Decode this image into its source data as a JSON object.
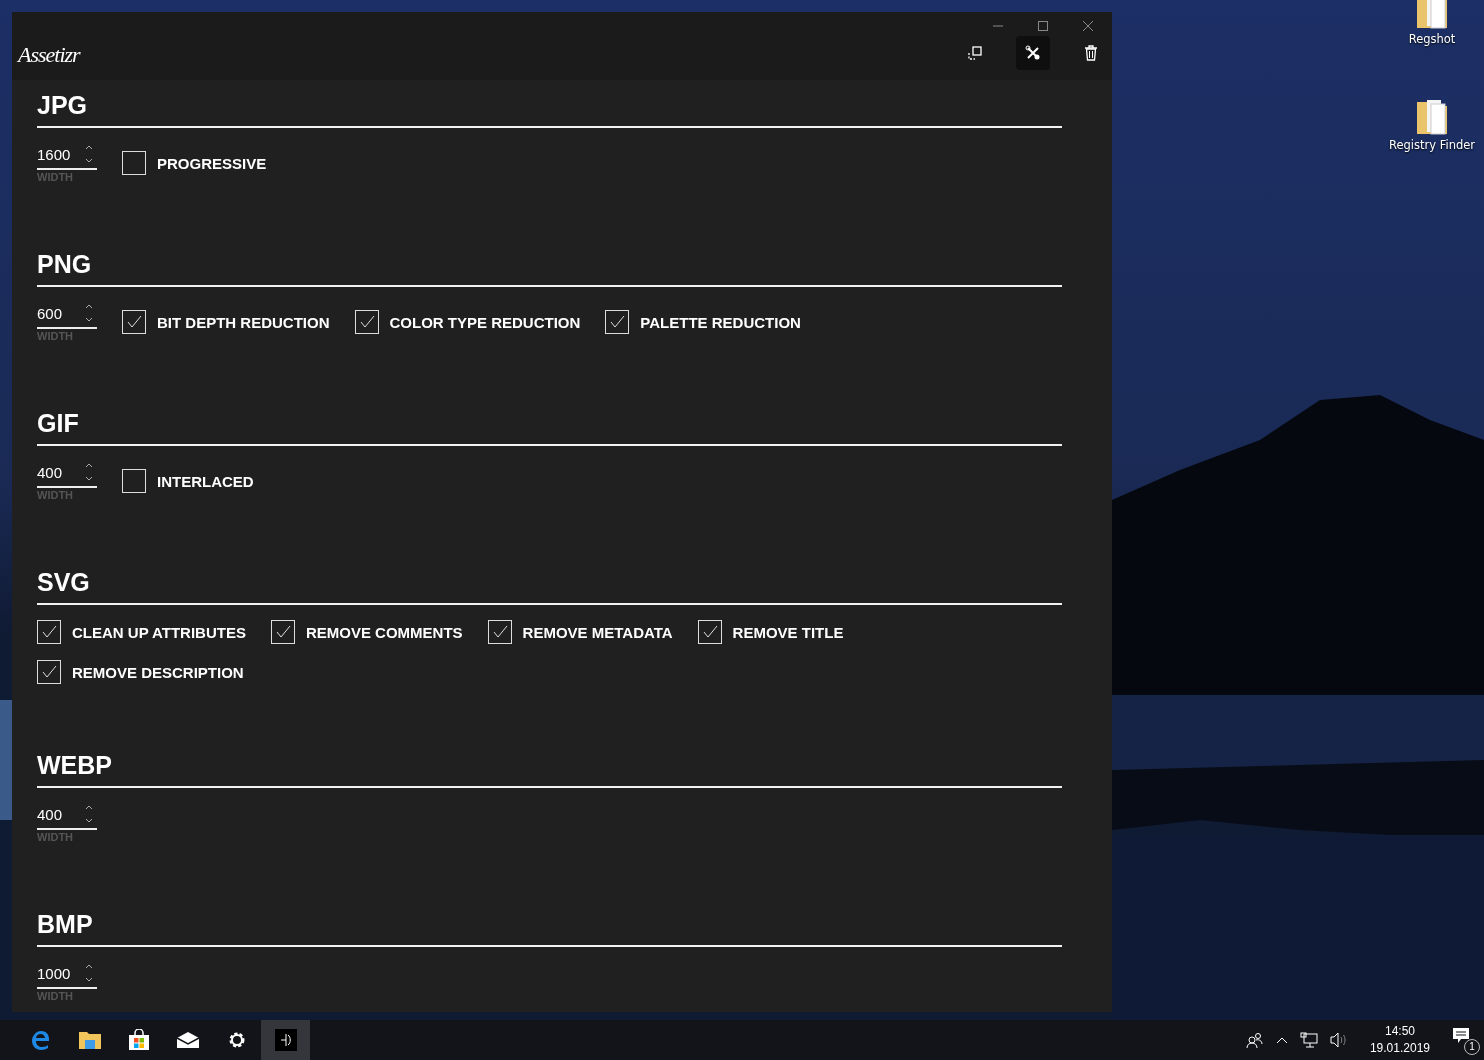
{
  "window": {
    "logo": "Assetizr",
    "caption_buttons": [
      {
        "kind": "minimize"
      },
      {
        "kind": "maximize"
      },
      {
        "kind": "close"
      }
    ],
    "toolbar": [
      {
        "kind": "resize",
        "selected": false
      },
      {
        "kind": "settings",
        "selected": true
      },
      {
        "kind": "delete",
        "selected": false
      }
    ]
  },
  "sections": [
    {
      "title": "JPG",
      "width": {
        "value": "1600",
        "label": "WIDTH"
      },
      "options": [
        {
          "label": "PROGRESSIVE",
          "checked": false
        }
      ]
    },
    {
      "title": "PNG",
      "width": {
        "value": "600",
        "label": "WIDTH"
      },
      "options": [
        {
          "label": "BIT DEPTH REDUCTION",
          "checked": true
        },
        {
          "label": "COLOR TYPE REDUCTION",
          "checked": true
        },
        {
          "label": "PALETTE REDUCTION",
          "checked": true
        }
      ]
    },
    {
      "title": "GIF",
      "width": {
        "value": "400",
        "label": "WIDTH"
      },
      "options": [
        {
          "label": "INTERLACED",
          "checked": false
        }
      ]
    },
    {
      "title": "SVG",
      "options": [
        {
          "label": "CLEAN UP ATTRIBUTES",
          "checked": true
        },
        {
          "label": "REMOVE COMMENTS",
          "checked": true
        },
        {
          "label": "REMOVE METADATA",
          "checked": true
        },
        {
          "label": "REMOVE TITLE",
          "checked": true
        },
        {
          "label": "REMOVE DESCRIPTION",
          "checked": true
        }
      ]
    },
    {
      "title": "WEBP",
      "width": {
        "value": "400",
        "label": "WIDTH"
      }
    },
    {
      "title": "BMP",
      "width": {
        "value": "1000",
        "label": "WIDTH"
      }
    }
  ],
  "desktop_icons": [
    {
      "label": "Regshot"
    },
    {
      "label": "Registry Finder"
    }
  ],
  "taskbar": {
    "apps": [
      {
        "kind": "edge",
        "selected": false
      },
      {
        "kind": "explorer",
        "selected": false
      },
      {
        "kind": "store",
        "selected": false
      },
      {
        "kind": "mail",
        "selected": false
      },
      {
        "kind": "settings",
        "selected": false
      },
      {
        "kind": "assetizr",
        "selected": true
      }
    ],
    "clock": {
      "time": "14:50",
      "date": "19.01.2019"
    },
    "notifications": "1"
  }
}
